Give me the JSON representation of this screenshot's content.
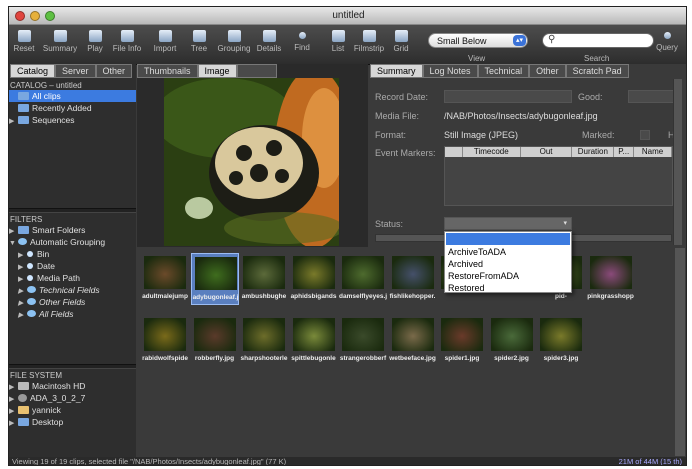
{
  "window": {
    "title": "untitled"
  },
  "toolbar": {
    "buttons": [
      "Reset",
      "Summary",
      "Play",
      "File Info",
      "Import",
      "Tree",
      "Grouping",
      "Details",
      "Find",
      "List",
      "Filmstrip",
      "Grid"
    ],
    "view_select": "Small Below",
    "view_label": "View",
    "search_label": "Search",
    "query_label": "Query"
  },
  "left_tabs": [
    "Catalog",
    "Server",
    "Other"
  ],
  "catalog": {
    "header": "CATALOG – untitled",
    "items": [
      "All clips",
      "Recently Added",
      "Sequences"
    ]
  },
  "filters": {
    "header": "FILTERS",
    "items": [
      "Smart Folders",
      "Automatic Grouping",
      "Bin",
      "Date",
      "Media Path",
      "Technical Fields",
      "Other Fields",
      "All Fields"
    ]
  },
  "filesystem": {
    "header": "FILE SYSTEM",
    "items": [
      "Macintosh HD",
      "ADA_3_0_2_7",
      "yannick",
      "Desktop"
    ]
  },
  "viewer_tabs": [
    "Thumbnails",
    "Image"
  ],
  "info_tabs": [
    "Summary",
    "Log Notes",
    "Technical",
    "Other",
    "Scratch Pad"
  ],
  "info": {
    "record_date_label": "Record Date:",
    "good_label": "Good:",
    "media_file_label": "Media File:",
    "media_file_value": "/NAB/Photos/Insects/adybugonleaf.jpg",
    "format_label": "Format:",
    "format_value": "Still Image (JPEG)",
    "marked_label": "Marked:",
    "h_label": "H",
    "event_markers_label": "Event Markers:",
    "marker_columns": [
      "Timecode",
      "Out",
      "Duration",
      "P...",
      "Name"
    ],
    "status_label": "Status:"
  },
  "status_options": [
    "ArchiveToADA",
    "Archived",
    "RestoreFromADA",
    "Restored"
  ],
  "thumbnails_row1": [
    "adultmalejump",
    "adybugonleaf.j",
    "ambushbughe",
    "aphidsbigands",
    "damselflyeyes.j",
    "fishlikehopper.",
    "",
    "",
    "pid-",
    "pinkgrasshopp"
  ],
  "thumbnails_row2": [
    "rabidwolfspide",
    "robberfly.jpg",
    "sharpshooterle",
    "spittlebugonle",
    "strangerobberf",
    "wetbeeface.jpg",
    "spider1.jpg",
    "spider2.jpg",
    "spider3.jpg"
  ],
  "status_bar": "Viewing 19 of 19 clips, selected file \"/NAB/Photos/Insects/adybugonleaf.jpg\" (77 K)",
  "memory": "21M of 44M (15 th)"
}
